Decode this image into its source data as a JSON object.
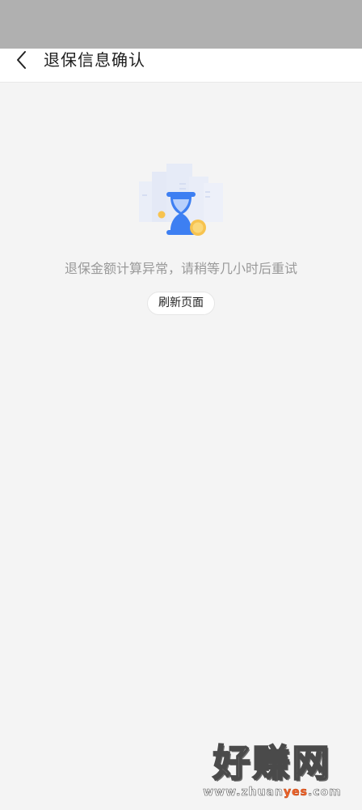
{
  "status_bar": {},
  "header": {
    "back_icon": "chevron-left-icon",
    "title": "退保信息确认"
  },
  "empty_state": {
    "illustration_icon": "hourglass-icon",
    "message": "退保金额计算异常，请稍等几小时后重试",
    "refresh_label": "刷新页面"
  },
  "watermark": {
    "title": "好赚网",
    "url_prefix": "www.zhuan",
    "url_highlight": "yes",
    "url_suffix": ".com"
  },
  "colors": {
    "status_bar": "#b0b0b0",
    "background": "#f4f4f4",
    "hourglass_blue": "#3d7ff2",
    "coin_yellow": "#f7c34f",
    "watermark_highlight": "#f0642a"
  }
}
